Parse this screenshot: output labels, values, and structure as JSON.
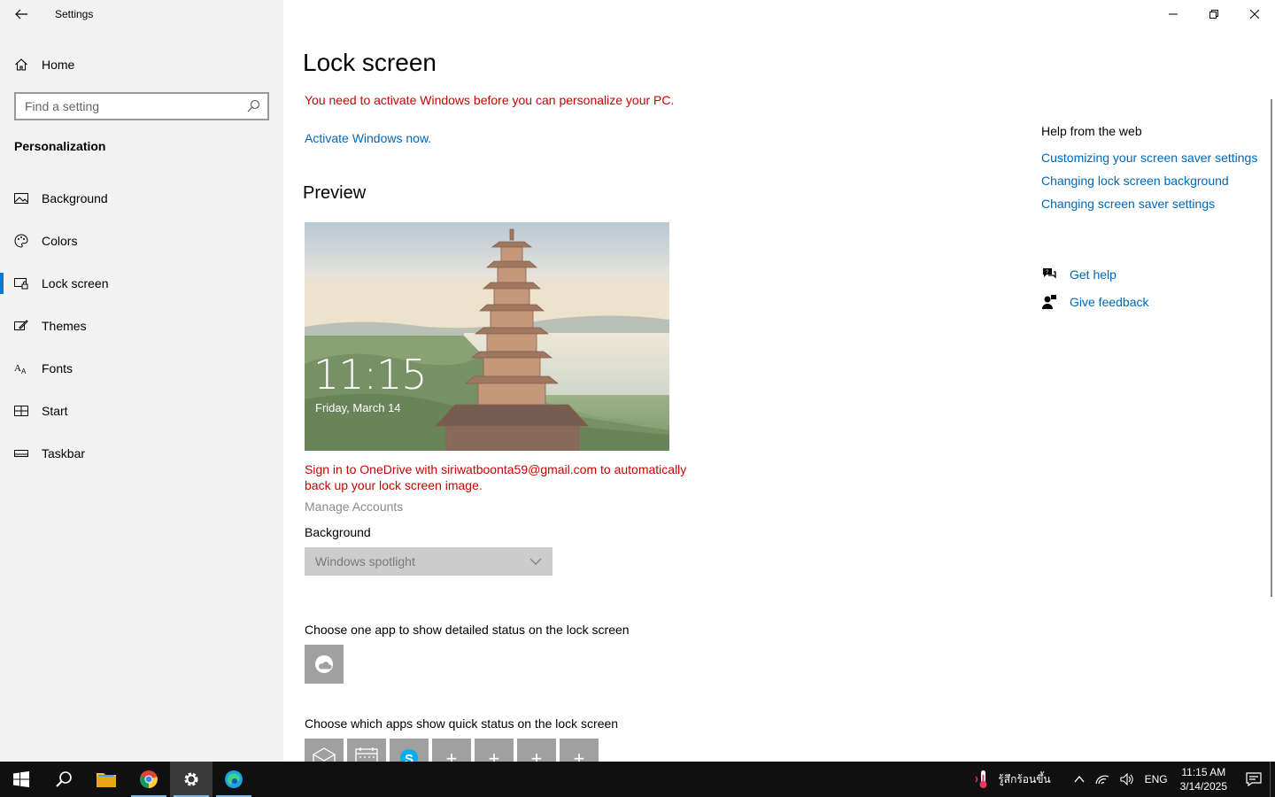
{
  "window": {
    "title": "Settings",
    "controls": [
      "minimize",
      "restore",
      "close"
    ]
  },
  "sidebar": {
    "home_label": "Home",
    "search_placeholder": "Find a setting",
    "section_title": "Personalization",
    "items": [
      {
        "label": "Background",
        "icon": "picture-icon"
      },
      {
        "label": "Colors",
        "icon": "palette-icon"
      },
      {
        "label": "Lock screen",
        "icon": "lock-screen-icon",
        "active": true
      },
      {
        "label": "Themes",
        "icon": "themes-icon"
      },
      {
        "label": "Fonts",
        "icon": "fonts-icon"
      },
      {
        "label": "Start",
        "icon": "start-icon"
      },
      {
        "label": "Taskbar",
        "icon": "taskbar-icon"
      }
    ]
  },
  "main": {
    "title": "Lock screen",
    "activation_warning": "You need to activate Windows before you can personalize your PC.",
    "activate_link": "Activate Windows now.",
    "preview_heading": "Preview",
    "preview_time": "11:15",
    "preview_date": "Friday, March 14",
    "onedrive_message": "Sign in to OneDrive with siriwatboonta59@gmail.com to automatically back up your lock screen image.",
    "manage_accounts": "Manage Accounts",
    "background_label": "Background",
    "background_value": "Windows spotlight",
    "detailed_status_label": "Choose one app to show detailed status on the lock screen",
    "quick_status_label": "Choose which apps show quick status on the lock screen"
  },
  "help": {
    "title": "Help from the web",
    "links": [
      "Customizing your screen saver settings",
      "Changing lock screen background",
      "Changing screen saver settings"
    ],
    "get_help": "Get help",
    "give_feedback": "Give feedback"
  },
  "taskbar": {
    "weather_text": "รู้สึกร้อนขึ้น",
    "language": "ENG",
    "time": "11:15 AM",
    "date": "3/14/2025"
  },
  "colors": {
    "accent": "#0078d7",
    "link": "#0067b8",
    "warning": "#c50500"
  }
}
